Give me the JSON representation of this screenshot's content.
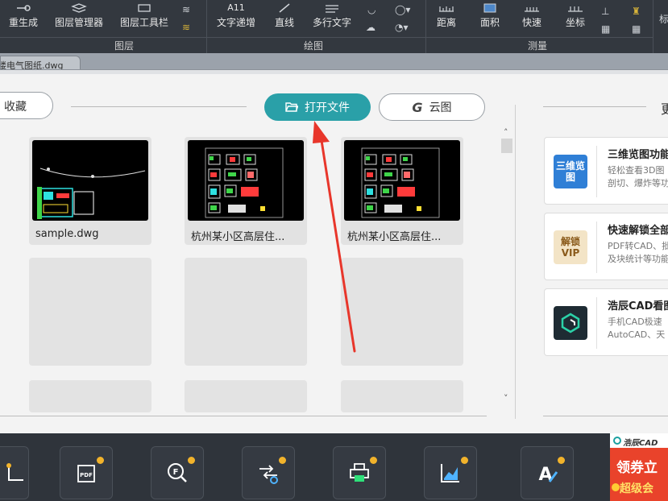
{
  "ribbon": {
    "groups": [
      {
        "label": "图层",
        "buttons": [
          "重生成",
          "图层管理器",
          "图层工具栏"
        ]
      },
      {
        "label": "绘图",
        "buttons": [
          "文字递增",
          "直线",
          "多行文字"
        ]
      },
      {
        "label": "测量",
        "buttons": [
          "距离",
          "面积",
          "快速",
          "坐标"
        ]
      }
    ],
    "text_icon": "A11",
    "right_partial": "标"
  },
  "tabs": [
    {
      "label": "楼电气图纸.dwg",
      "active": true
    }
  ],
  "main": {
    "favorites_label": "收藏",
    "open_file_label": "打开文件",
    "cloud_label": "云图",
    "right_heading": "更"
  },
  "recent_files": [
    {
      "name": "sample.dwg"
    },
    {
      "name": "杭州某小区高层住..."
    },
    {
      "name": "杭州某小区高层住..."
    }
  ],
  "promos": [
    {
      "title": "三维览图功能",
      "desc1": "轻松查看3D图",
      "desc2": "剖切、爆炸等功",
      "icon_text": "三维览图",
      "icon_bg": "#2f7fd6",
      "icon_fg": "#ffffff"
    },
    {
      "title": "快速解锁全部",
      "desc1": "PDF转CAD、批",
      "desc2": "及块统计等功能",
      "icon_text": "解锁VIP",
      "icon_bg": "#f3e4c6",
      "icon_fg": "#8a5a1a"
    },
    {
      "title": "浩辰CAD看图",
      "desc1": "手机CAD极速",
      "desc2": "AutoCAD、天",
      "icon_text": "",
      "icon_bg": "#1e2b33",
      "icon_fg": "#2bd1a8"
    }
  ],
  "bottom_tools": [
    {
      "name": "measure-tool",
      "icon": "crop-icon"
    },
    {
      "name": "pdf-tool",
      "icon": "pdf-convert-icon",
      "text": "PDF"
    },
    {
      "name": "find-tool",
      "icon": "find-text-icon",
      "text": "F"
    },
    {
      "name": "convert-tool",
      "icon": "convert-settings-icon"
    },
    {
      "name": "print-tool",
      "icon": "print-icon"
    },
    {
      "name": "chart-tool",
      "icon": "chart-icon"
    },
    {
      "name": "text-tool",
      "icon": "text-edit-icon",
      "text": "A"
    }
  ],
  "ad": {
    "brand": "浩辰CAD",
    "main": "领券立",
    "sub": "超级会"
  },
  "colors": {
    "accent": "#2aa0a8",
    "ribbon_bg": "#33383f",
    "toolbar_bg": "#2f343b",
    "arrow": "#e8362b"
  }
}
